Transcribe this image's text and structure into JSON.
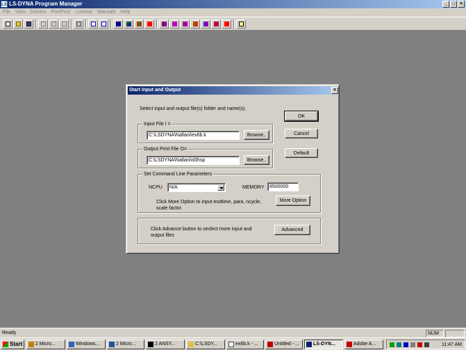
{
  "window": {
    "title": "LS-DYNA Program Manager",
    "icon_text": "LS",
    "controls": [
      "_",
      "□",
      "×"
    ]
  },
  "menu": [
    "File",
    "View",
    "Solvers",
    "Pre/Post",
    "License",
    "Manuals",
    "Help"
  ],
  "toolbar": {
    "icons": [
      "new-icon",
      "open-icon",
      "save-icon",
      "cut-icon",
      "copy-icon",
      "paste-icon",
      "print-icon",
      "import-icon",
      "export-icon",
      "chart-icon",
      "model-icon",
      "grid-icon",
      "solver-icon",
      "run-icon-1",
      "run-icon-2",
      "run-icon-3",
      "run-icon-4",
      "run-icon-5",
      "run-icon-6",
      "run-icon-7",
      "help-icon"
    ],
    "accent_colors": [
      "#000080",
      "#008000",
      "#ff0000",
      "#800080"
    ]
  },
  "dialog": {
    "title": "Start Input and Output",
    "close": "×",
    "instruction": "Select input and output file(s) folder and name(s).",
    "input_file": {
      "label": "Input File  I =",
      "value": "C:\\LSDYNA\\Nallani\\ex6b.k",
      "browse": "Browse.."
    },
    "output_file": {
      "label": "Output Print File  O=",
      "value": "C:\\LSDYNA\\Nallani\\d3hsp",
      "browse": "Browse.."
    },
    "buttons": {
      "ok": "OK",
      "cancel": "Cancel",
      "default": "Default",
      "more_option": "More Option",
      "advanced": "Advanced"
    },
    "cmd_params": {
      "label": "Set Command Line Parameters",
      "ncpu_label": "NCPU",
      "ncpu_value": "N/A",
      "memory_label": "MEMORY",
      "memory_value": "8500000",
      "more_text_line1": "Click More Option to input endtime, para, ncycle,",
      "more_text_line2": "scale factor."
    },
    "advanced_text_line1": "Click Advance button to seclect more input and",
    "advanced_text_line2": "output files"
  },
  "statusbar": {
    "status": "Ready",
    "num": "NUM"
  },
  "taskbar": {
    "start": "Start",
    "tasks": [
      {
        "label": "2 Micro...",
        "icon_color": "#c08000"
      },
      {
        "label": "Windows...",
        "icon_color": "#3060c0"
      },
      {
        "label": "2 Micro...",
        "icon_color": "#2050a0"
      },
      {
        "label": "2 ANSY...",
        "icon_color": "#000000"
      },
      {
        "label": "C:\\LSDY...",
        "icon_color": "#e0c040"
      },
      {
        "label": "ex6b.k - ...",
        "icon_color": "#ffffff"
      },
      {
        "label": "Untitled - ...",
        "icon_color": "#c00000"
      },
      {
        "label": "LS-DYN...",
        "icon_color": "#0a246a",
        "active": true
      },
      {
        "label": "Adobe A...",
        "icon_color": "#c00000"
      }
    ],
    "clock": "11:47 AM"
  }
}
